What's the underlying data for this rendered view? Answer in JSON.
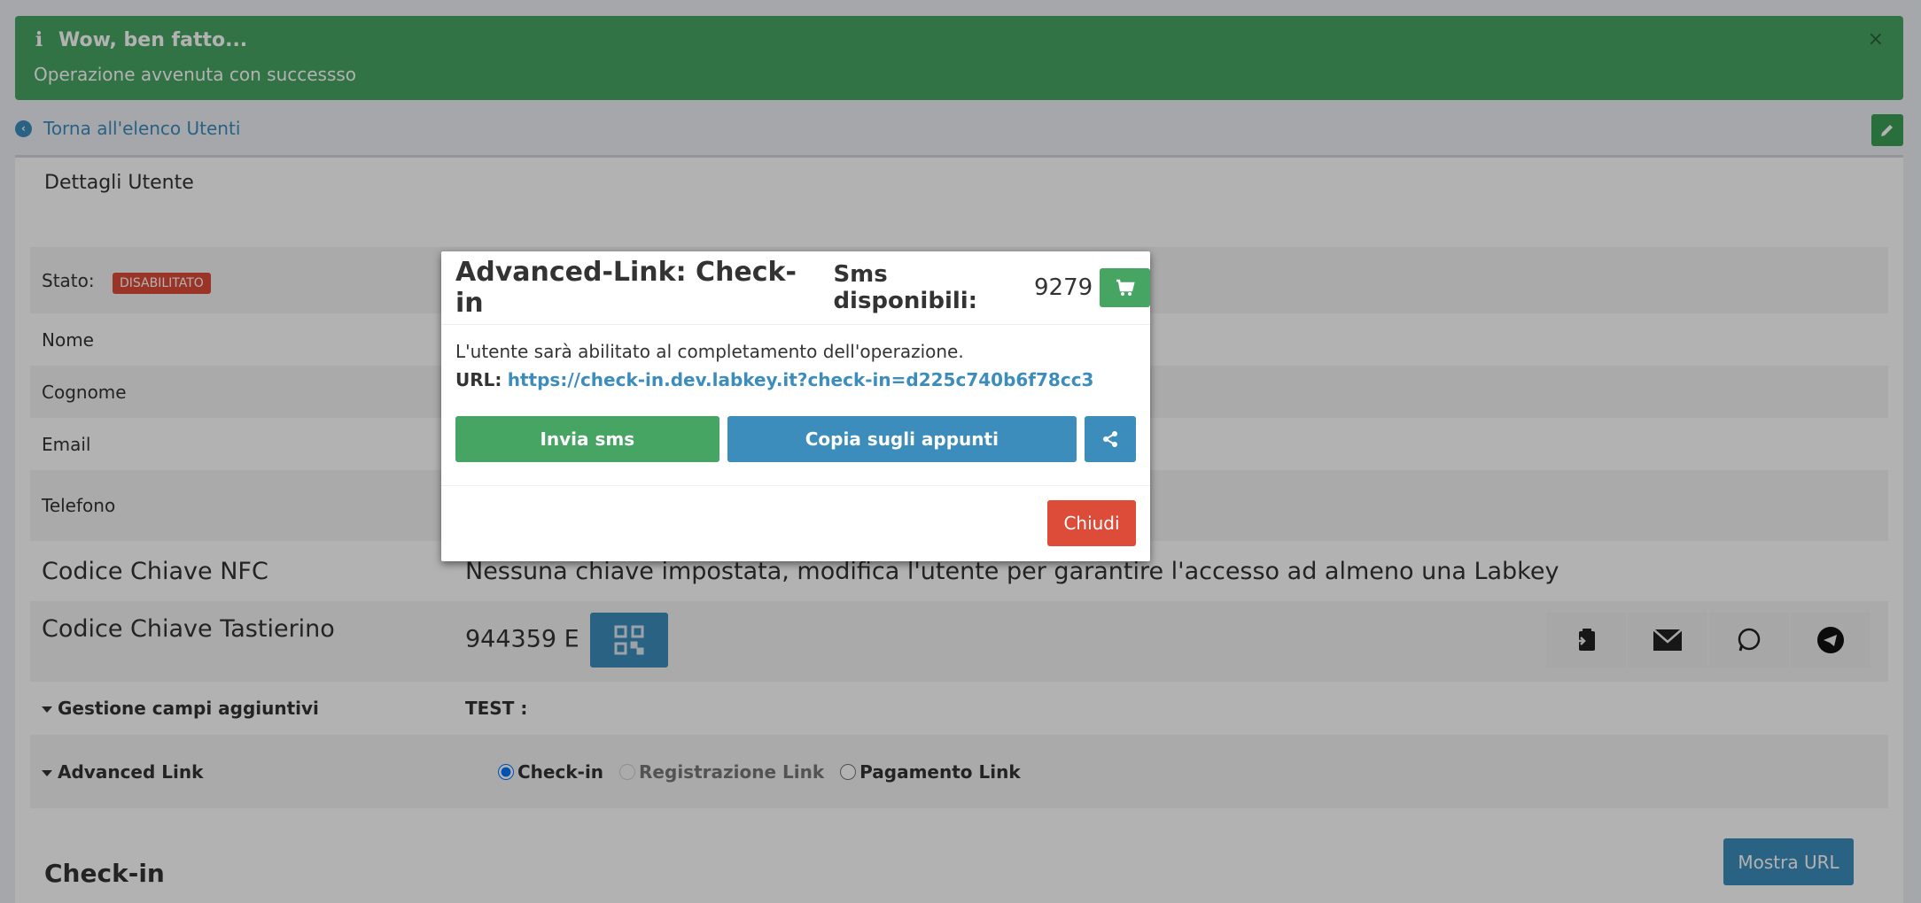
{
  "alert": {
    "title": "Wow, ben fatto...",
    "message": "Operazione avvenuta con successso",
    "close": "×",
    "icon": "info-icon",
    "color": "#47a563"
  },
  "nav": {
    "back_label": "Torna all'elenco Utenti"
  },
  "box": {
    "title": "Dettagli Utente"
  },
  "fields": {
    "stato_label": "Stato:",
    "stato_badge": "DISABILITATO",
    "nome_label": "Nome",
    "cognome_label": "Cognome",
    "email_label": "Email",
    "telefono_label": "Telefono",
    "nfc_label": "Codice Chiave NFC",
    "nfc_value": "Nessuna chiave impostata, modifica l'utente per garantire l'accesso ad almeno una Labkey",
    "tastierino_label": "Codice Chiave Tastierino",
    "tastierino_value": "944359 E",
    "campi_label": "Gestione campi aggiuntivi",
    "campi_value": "TEST :",
    "advanced_label": "Advanced Link"
  },
  "advanced_link": {
    "options": [
      "Check-in",
      "Registrazione Link",
      "Pagamento Link"
    ],
    "selected": "Check-in",
    "section_title": "Check-in",
    "mostra_url": "Mostra URL"
  },
  "modal": {
    "title": "Advanced-Link: Check-in",
    "sms_label": "Sms disponibili:",
    "sms_count": "9279",
    "body_text": "L'utente sarà abilitato al completamento dell'operazione.",
    "url_label": "URL:",
    "url": "https://check-in.dev.labkey.it?check-in=d225c740b6f78cc3",
    "send_sms": "Invia sms",
    "copy": "Copia sugli appunti",
    "close": "Chiudi"
  }
}
